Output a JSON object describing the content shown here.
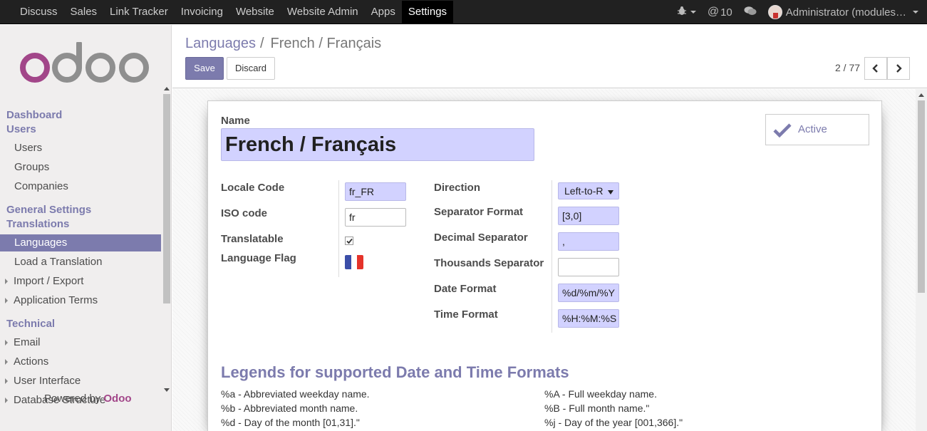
{
  "topbar": {
    "menu": [
      "Discuss",
      "Sales",
      "Link Tracker",
      "Invoicing",
      "Website",
      "Website Admin",
      "Apps",
      "Settings"
    ],
    "active_menu": "Settings",
    "messages_count": "10",
    "user_name": "Administrator (modules…"
  },
  "sidebar": {
    "sections": [
      {
        "label": "Dashboard",
        "type": "head"
      },
      {
        "label": "Users",
        "type": "head"
      },
      {
        "label": "Users",
        "type": "sub"
      },
      {
        "label": "Groups",
        "type": "sub"
      },
      {
        "label": "Companies",
        "type": "sub"
      },
      {
        "label": "General Settings",
        "type": "head"
      },
      {
        "label": "Translations",
        "type": "head"
      },
      {
        "label": "Languages",
        "type": "sub",
        "active": true
      },
      {
        "label": "Load a Translation",
        "type": "sub"
      },
      {
        "label": "Import / Export",
        "type": "exp"
      },
      {
        "label": "Application Terms",
        "type": "exp"
      },
      {
        "label": "Technical",
        "type": "head"
      },
      {
        "label": "Email",
        "type": "exp"
      },
      {
        "label": "Actions",
        "type": "exp"
      },
      {
        "label": "User Interface",
        "type": "exp"
      },
      {
        "label": "Database Structure",
        "type": "exp"
      }
    ],
    "powered_by": "Powered by",
    "powered_brand": "Odoo"
  },
  "control_panel": {
    "breadcrumb_parent": "Languages",
    "breadcrumb_sep": "/",
    "breadcrumb_current": "French / Français",
    "save_label": "Save",
    "discard_label": "Discard",
    "pager": "2 / 77"
  },
  "form": {
    "name_label": "Name",
    "name_value": "French / Français",
    "active_label": "Active",
    "locale_code_label": "Locale Code",
    "locale_code_value": "fr_FR",
    "iso_code_label": "ISO code",
    "iso_code_value": "fr",
    "translatable_label": "Translatable",
    "translatable_checked": true,
    "flag_label": "Language Flag",
    "direction_label": "Direction",
    "direction_value": "Left-to-R",
    "separator_format_label": "Separator Format",
    "separator_format_value": "[3,0]",
    "decimal_separator_label": "Decimal Separator",
    "decimal_separator_value": ",",
    "thousands_separator_label": "Thousands Separator",
    "thousands_separator_value": "",
    "date_format_label": "Date Format",
    "date_format_value": "%d/%m/%Y",
    "time_format_label": "Time Format",
    "time_format_value": "%H:%M:%S"
  },
  "legend": {
    "title": "Legends for supported Date and Time Formats",
    "left": [
      "%a - Abbreviated weekday name.",
      "%b - Abbreviated month name.",
      "%d - Day of the month [01,31].\""
    ],
    "right": [
      "%A - Full weekday name.",
      "%B - Full month name.\"",
      "%j - Day of the year [001,366].\""
    ]
  },
  "colors": {
    "brand": "#7c7bad",
    "required_field": "#d2d2ff",
    "logo_o": "#a24689",
    "logo_doo": "#8f8f8f"
  }
}
